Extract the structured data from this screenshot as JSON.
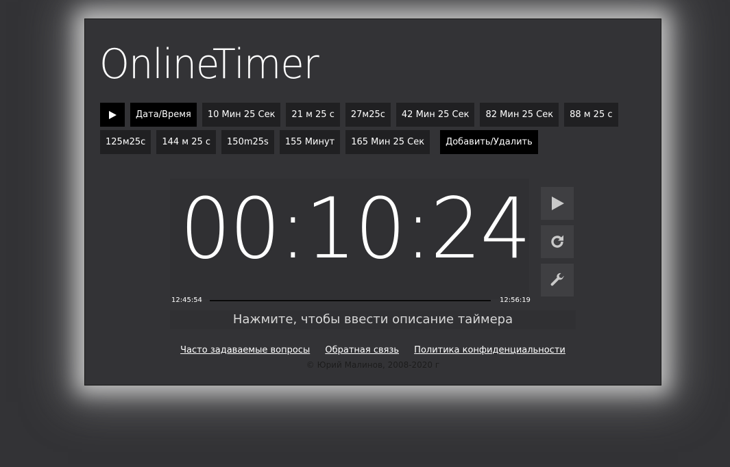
{
  "logo": "OnlineTimer",
  "presets": {
    "row1": [
      "Дата/Время",
      "10 Мин 25 Сек",
      "21 м 25 с",
      "27м25с",
      "42 Мин 25 Сек",
      "82 Мин 25 Сек",
      "88 м 25 с"
    ],
    "row2": [
      "125м25с",
      "144 м 25 с",
      "150m25s",
      "155 Минут",
      "165 Мин 25 Сек"
    ],
    "add_remove": "Добавить/Удалить"
  },
  "timer": {
    "display": "00:10:24",
    "start_time": "12:45:54",
    "end_time": "12:56:19",
    "progress": 0.0
  },
  "description_placeholder": "Нажмите, чтобы ввести описание таймера",
  "footer": {
    "faq": "Часто задаваемые вопросы",
    "feedback": "Обратная связь",
    "privacy": "Политика конфиденциальности",
    "copyright": "© Юрий Малинов, 2008-2020 г"
  },
  "icons": {
    "quick_play": "play-icon",
    "start": "play-icon",
    "reset": "refresh-icon",
    "settings": "wrench-icon"
  },
  "colors": {
    "background": "#333336",
    "preset_button": "#202022",
    "side_button": "#3f3f42",
    "glow": "#bdbdbd"
  }
}
